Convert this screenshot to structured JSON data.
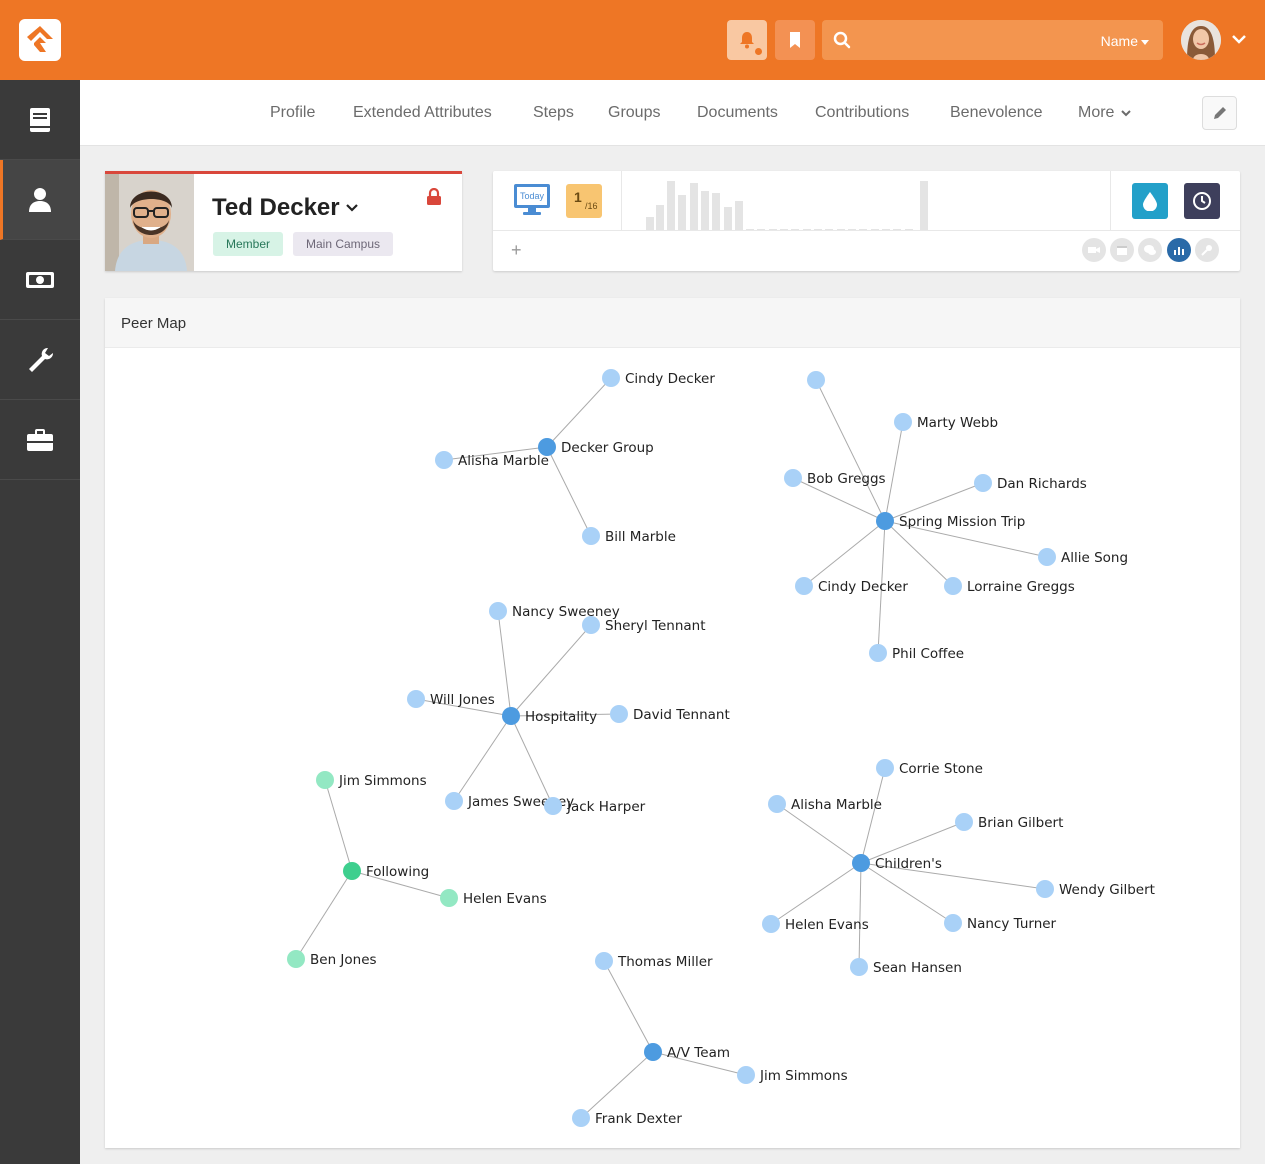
{
  "header": {
    "search_placeholder": "",
    "search_type": "Name"
  },
  "sidebar": {
    "items": [
      {
        "icon": "book-icon"
      },
      {
        "icon": "person-icon",
        "active": true
      },
      {
        "icon": "money-icon"
      },
      {
        "icon": "wrench-icon"
      },
      {
        "icon": "briefcase-icon"
      }
    ]
  },
  "tabs": [
    "Profile",
    "Extended Attributes",
    "Steps",
    "Groups",
    "Documents",
    "Contributions",
    "Benevolence",
    "More"
  ],
  "person": {
    "name": "Ted Decker",
    "badges": [
      "Member",
      "Main Campus"
    ]
  },
  "badge_bar": {
    "today_label": "Today",
    "attendance_num": "1",
    "attendance_den": "/16",
    "add_label": "+"
  },
  "peer_map": {
    "title": "Peer Map",
    "colors": {
      "group": "#4d9be0",
      "member": "#a9d1f7",
      "following_group": "#3ecf8e",
      "following_member": "#93e8c3",
      "edge": "#aaaaaa"
    },
    "nodes": [
      {
        "id": "g1",
        "label": "Decker Group",
        "kind": "group"
      },
      {
        "id": "n1",
        "label": "Cindy Decker",
        "kind": "member"
      },
      {
        "id": "n2",
        "label": "Alisha Marble",
        "kind": "member"
      },
      {
        "id": "n3",
        "label": "Bill Marble",
        "kind": "member"
      },
      {
        "id": "g2",
        "label": "Spring Mission Trip",
        "kind": "group"
      },
      {
        "id": "n4",
        "label": "",
        "kind": "member"
      },
      {
        "id": "n5",
        "label": "Marty Webb",
        "kind": "member"
      },
      {
        "id": "n6",
        "label": "Bob Greggs",
        "kind": "member"
      },
      {
        "id": "n7",
        "label": "Dan Richards",
        "kind": "member"
      },
      {
        "id": "n8",
        "label": "Allie Song",
        "kind": "member"
      },
      {
        "id": "n9",
        "label": "Cindy Decker",
        "kind": "member"
      },
      {
        "id": "n10",
        "label": "Lorraine Greggs",
        "kind": "member"
      },
      {
        "id": "n11",
        "label": "Phil Coffee",
        "kind": "member"
      },
      {
        "id": "g3",
        "label": "Hospitality",
        "kind": "group"
      },
      {
        "id": "n12",
        "label": "Nancy Sweeney",
        "kind": "member"
      },
      {
        "id": "n13",
        "label": "Sheryl Tennant",
        "kind": "member"
      },
      {
        "id": "n14",
        "label": "Will Jones",
        "kind": "member"
      },
      {
        "id": "n15",
        "label": "David Tennant",
        "kind": "member"
      },
      {
        "id": "n16",
        "label": "James Sweeney",
        "kind": "member"
      },
      {
        "id": "n17",
        "label": "Jack Harper",
        "kind": "member"
      },
      {
        "id": "g4",
        "label": "Following",
        "kind": "following_group"
      },
      {
        "id": "n18",
        "label": "Jim Simmons",
        "kind": "following_member"
      },
      {
        "id": "n19",
        "label": "Helen Evans",
        "kind": "following_member"
      },
      {
        "id": "n20",
        "label": "Ben Jones",
        "kind": "following_member"
      },
      {
        "id": "g5",
        "label": "Children's",
        "kind": "group"
      },
      {
        "id": "n21",
        "label": "Corrie Stone",
        "kind": "member"
      },
      {
        "id": "n22",
        "label": "Alisha Marble",
        "kind": "member"
      },
      {
        "id": "n23",
        "label": "Brian Gilbert",
        "kind": "member"
      },
      {
        "id": "n24",
        "label": "Wendy Gilbert",
        "kind": "member"
      },
      {
        "id": "n25",
        "label": "Helen Evans",
        "kind": "member"
      },
      {
        "id": "n26",
        "label": "Nancy Turner",
        "kind": "member"
      },
      {
        "id": "n27",
        "label": "Sean Hansen",
        "kind": "member"
      },
      {
        "id": "g6",
        "label": "A/V Team",
        "kind": "group"
      },
      {
        "id": "n28",
        "label": "Thomas Miller",
        "kind": "member"
      },
      {
        "id": "n29",
        "label": "Jim Simmons",
        "kind": "member"
      },
      {
        "id": "n30",
        "label": "Frank Dexter",
        "kind": "member"
      }
    ],
    "edges": [
      [
        "g1",
        "n1"
      ],
      [
        "g1",
        "n2"
      ],
      [
        "g1",
        "n3"
      ],
      [
        "g2",
        "n4"
      ],
      [
        "g2",
        "n5"
      ],
      [
        "g2",
        "n6"
      ],
      [
        "g2",
        "n7"
      ],
      [
        "g2",
        "n8"
      ],
      [
        "g2",
        "n9"
      ],
      [
        "g2",
        "n10"
      ],
      [
        "g2",
        "n11"
      ],
      [
        "g3",
        "n12"
      ],
      [
        "g3",
        "n13"
      ],
      [
        "g3",
        "n14"
      ],
      [
        "g3",
        "n15"
      ],
      [
        "g3",
        "n16"
      ],
      [
        "g3",
        "n17"
      ],
      [
        "g4",
        "n18"
      ],
      [
        "g4",
        "n19"
      ],
      [
        "g4",
        "n20"
      ],
      [
        "g5",
        "n21"
      ],
      [
        "g5",
        "n22"
      ],
      [
        "g5",
        "n23"
      ],
      [
        "g5",
        "n24"
      ],
      [
        "g5",
        "n25"
      ],
      [
        "g5",
        "n26"
      ],
      [
        "g5",
        "n27"
      ],
      [
        "g6",
        "n28"
      ],
      [
        "g6",
        "n29"
      ],
      [
        "g6",
        "n30"
      ]
    ]
  }
}
